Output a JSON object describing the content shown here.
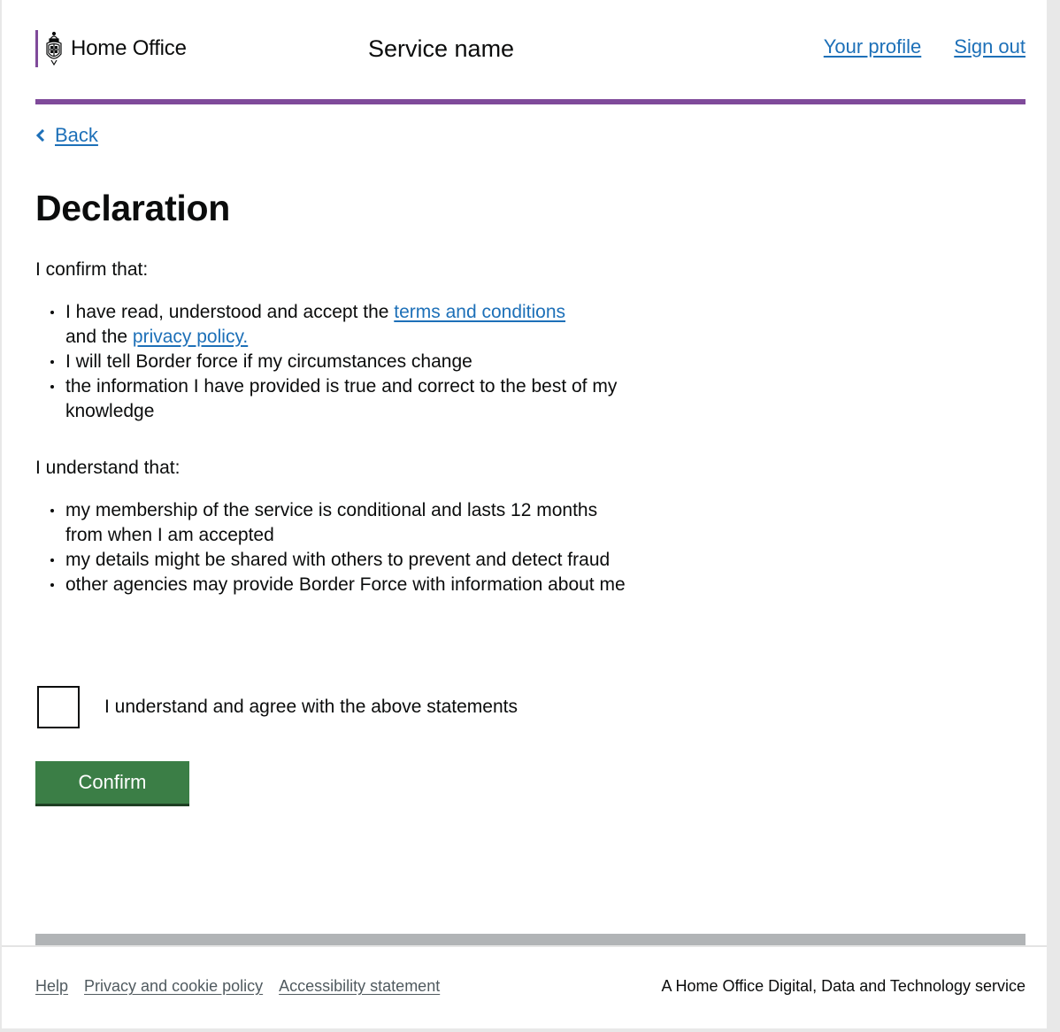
{
  "header": {
    "brand_name": "Home Office",
    "brand_icon": "royal-crest-icon",
    "service_name": "Service name",
    "nav": [
      {
        "label": "Your profile"
      },
      {
        "label": "Sign out"
      }
    ]
  },
  "colors": {
    "brand_purple": "#7f4a9a",
    "link_blue": "#1d70b8",
    "button_green": "#3b7e46",
    "text": "#0b0c0c",
    "footer_rule": "#b1b4b6"
  },
  "main": {
    "back_label": "Back",
    "back_icon": "chevron-left-icon",
    "title": "Declaration",
    "confirm_section": {
      "intro": "I confirm that:",
      "items": [
        {
          "text_before": "I have read, understood and accept the ",
          "link1": "terms and conditions",
          "text_middle": " and the ",
          "link2": "privacy policy."
        },
        {
          "text": "I will tell Border force if my circumstances change"
        },
        {
          "text": "the information I have provided is true and correct to the best of my knowledge"
        }
      ]
    },
    "understand_section": {
      "intro": "I understand that:",
      "items": [
        {
          "text": "my membership of the service is conditional and lasts 12 months from when I am accepted"
        },
        {
          "text": "my details might be shared with others to prevent and detect fraud"
        },
        {
          "text": "other agencies may provide Border Force with information about me"
        }
      ]
    },
    "agree_checkbox": {
      "label": "I understand and agree with the above statements",
      "checked": false
    },
    "confirm_button": "Confirm"
  },
  "footer": {
    "links": [
      {
        "label": "Help"
      },
      {
        "label": "Privacy and cookie policy"
      },
      {
        "label": "Accessibility statement"
      }
    ],
    "meta": "A Home Office Digital, Data and Technology service"
  }
}
